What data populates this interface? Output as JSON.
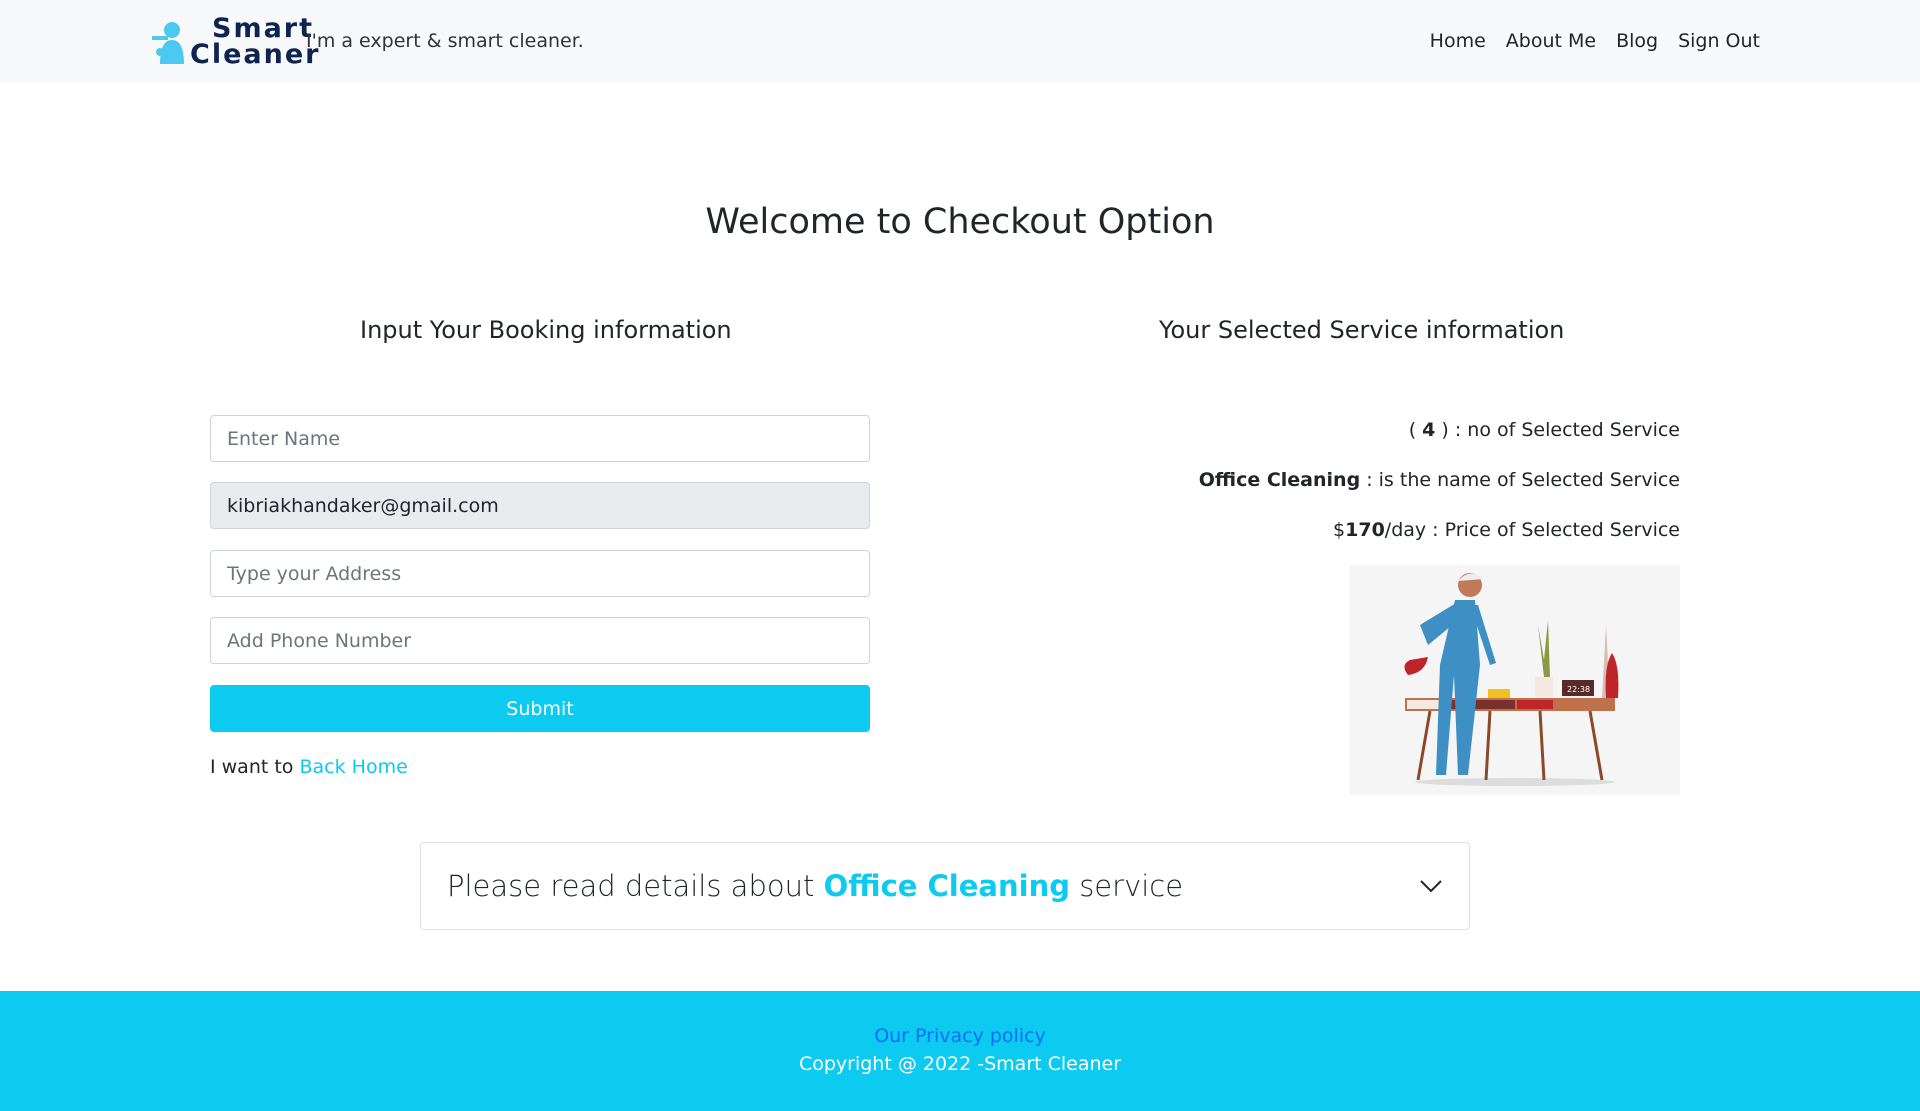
{
  "nav": {
    "logo_line1": "Smart",
    "logo_line2": "Cleaner",
    "tagline": "I'm a expert & smart cleaner.",
    "links": [
      "Home",
      "About Me",
      "Blog",
      "Sign Out"
    ]
  },
  "page_title": "Welcome to Checkout Option",
  "form": {
    "heading": "Input Your Booking information",
    "name_placeholder": "Enter Name",
    "email_value": "kibriakhandaker@gmail.com",
    "address_placeholder": "Type your Address",
    "phone_placeholder": "Add Phone Number",
    "submit_label": "Submit",
    "back_prefix": "I want to",
    "back_link": "Back Home"
  },
  "service": {
    "heading": "Your Selected Service information",
    "count_open": "( ",
    "count": "4",
    "count_suffix": " ) : no of Selected Service",
    "name": "Office Cleaning",
    "name_suffix": " : is the name of Selected Service",
    "price_prefix": "$",
    "price": "170",
    "price_suffix": "/day : Price of Selected Service",
    "clock": "22:38"
  },
  "accordion": {
    "prefix": "Please read details about ",
    "service": "Office Cleaning",
    "suffix": " service"
  },
  "footer": {
    "privacy": "Our Privacy policy",
    "copyright": "Copyright @ 2022 -Smart Cleaner"
  }
}
